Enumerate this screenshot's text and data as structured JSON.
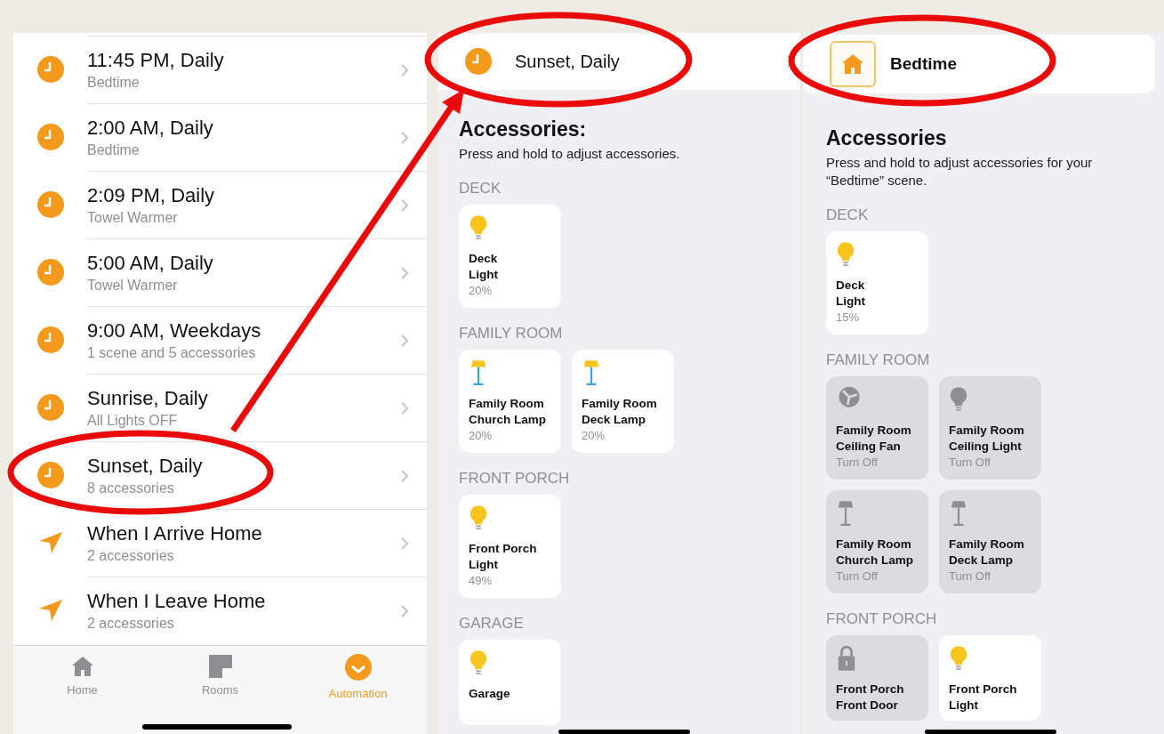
{
  "automation_list": {
    "rows": [
      {
        "kind": "clock",
        "title": "11:45 PM, Daily",
        "subtitle": "Bedtime"
      },
      {
        "kind": "clock",
        "title": "2:00 AM, Daily",
        "subtitle": "Bedtime"
      },
      {
        "kind": "clock",
        "title": "2:09 PM, Daily",
        "subtitle": "Towel Warmer"
      },
      {
        "kind": "clock",
        "title": "5:00 AM, Daily",
        "subtitle": "Towel Warmer"
      },
      {
        "kind": "clock",
        "title": "9:00 AM, Weekdays",
        "subtitle": "1 scene and 5 accessories"
      },
      {
        "kind": "clock",
        "title": "Sunrise, Daily",
        "subtitle": "All Lights OFF"
      },
      {
        "kind": "clock",
        "title": "Sunset, Daily",
        "subtitle": "8 accessories"
      },
      {
        "kind": "location",
        "title": "When I Arrive Home",
        "subtitle": "2 accessories"
      },
      {
        "kind": "location",
        "title": "When I Leave Home",
        "subtitle": "2 accessories"
      }
    ],
    "tab_bar": [
      {
        "kind": "home",
        "label": "Home",
        "selected": false
      },
      {
        "kind": "rooms",
        "label": "Rooms",
        "selected": false
      },
      {
        "kind": "automation",
        "label": "Automation",
        "selected": true
      }
    ]
  },
  "detail_screens": [
    {
      "header": {
        "kind": "clock",
        "title": "Sunset, Daily"
      },
      "heading": "Accessories:",
      "instruction": "Press and hold to adjust accessories.",
      "rooms": [
        {
          "name": "DECK",
          "accessories": [
            {
              "kind": "light",
              "on": true,
              "name": "Deck\nLight",
              "value": "20%"
            }
          ]
        },
        {
          "name": "FAMILY ROOM",
          "accessories": [
            {
              "kind": "lamp",
              "on": true,
              "name": "Family Room\nChurch Lamp",
              "value": "20%"
            },
            {
              "kind": "lamp",
              "on": true,
              "name": "Family Room\nDeck Lamp",
              "value": "20%"
            }
          ]
        },
        {
          "name": "FRONT PORCH",
          "accessories": [
            {
              "kind": "light",
              "on": true,
              "name": "Front Porch\nLight",
              "value": "49%"
            }
          ]
        },
        {
          "name": "GARAGE",
          "accessories": [
            {
              "kind": "light",
              "on": true,
              "name": "Garage"
            }
          ]
        }
      ]
    },
    {
      "header": {
        "kind": "home",
        "title": "Bedtime"
      },
      "heading": "Accessories",
      "instruction": "Press and hold to adjust accessories for your “Bedtime” scene.",
      "rooms": [
        {
          "name": "DECK",
          "accessories": [
            {
              "kind": "light",
              "on": true,
              "name": "Deck\nLight",
              "value": "15%"
            }
          ]
        },
        {
          "name": "FAMILY ROOM",
          "accessories": [
            {
              "kind": "fan",
              "on": false,
              "name": "Family Room\nCeiling Fan",
              "value": "Turn Off"
            },
            {
              "kind": "light",
              "on": false,
              "name": "Family Room\nCeiling Light",
              "value": "Turn Off"
            },
            {
              "kind": "lamp",
              "on": false,
              "name": "Family Room\nChurch Lamp",
              "value": "Turn Off"
            },
            {
              "kind": "lamp",
              "on": false,
              "name": "Family Room\nDeck Lamp",
              "value": "Turn Off"
            }
          ]
        },
        {
          "name": "FRONT PORCH",
          "accessories": [
            {
              "kind": "lock",
              "on": false,
              "name": "Front Porch\nFront Door"
            },
            {
              "kind": "light",
              "on": true,
              "name": "Front Porch\nLight"
            }
          ]
        }
      ]
    }
  ]
}
